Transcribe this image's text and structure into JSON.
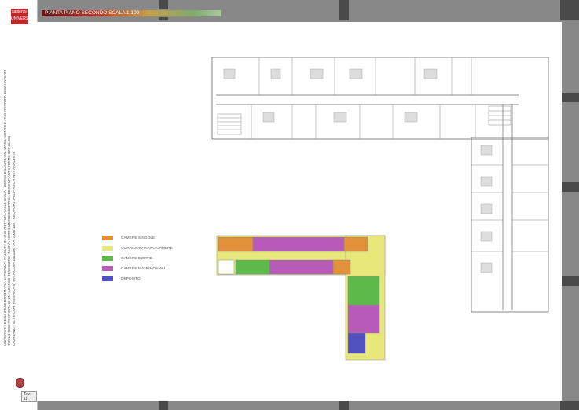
{
  "title": "PIANTA PIANO SECONDO SCALA 1:100",
  "logo_text": [
    "sapienza",
    "UNIVERSITÀ"
  ],
  "side_text": [
    "UNIVERSITA' DEGLI STUDI DI ROMA \"LA SAPIENZA\" - FACOLTA' DI ARCHITETTURA VALLE GIULIA - CORSO DI LAUREA IN ARREDAMENTO E ARCHITETTURA DEGLI INTERNI",
    "TITOLO TESI: PROPOSTA DI UN ALBERGO BENESSERE - NUOVA DISTRIBUZIONE ELETTRICA ED IN IMPIANTO TERMO IDRAULICO",
    "LAUREANDI: BOTTACCHI FEDERICA N° MATRICOLA 1502206 - A.A. 2006/2007 - RELATORE: PROF. ARCH. NUTIA VALENTE"
  ],
  "sheet_label": "Tav. 11",
  "legend": [
    {
      "label": "CAMERE SINGOLE",
      "color": "#e0913a"
    },
    {
      "label": "CORRIDOIO PIANO CAMERE",
      "color": "#e8e87a"
    },
    {
      "label": "CAMERE DOPPIE",
      "color": "#5dba4a"
    },
    {
      "label": "CAMERE MATRIMONIALI",
      "color": "#b85bb8"
    },
    {
      "label": "DEPOSITO",
      "color": "#5050c0"
    }
  ],
  "colors": {
    "frame": "#888888",
    "column": "#4a4a4a",
    "title_start": "#6b0e14"
  }
}
